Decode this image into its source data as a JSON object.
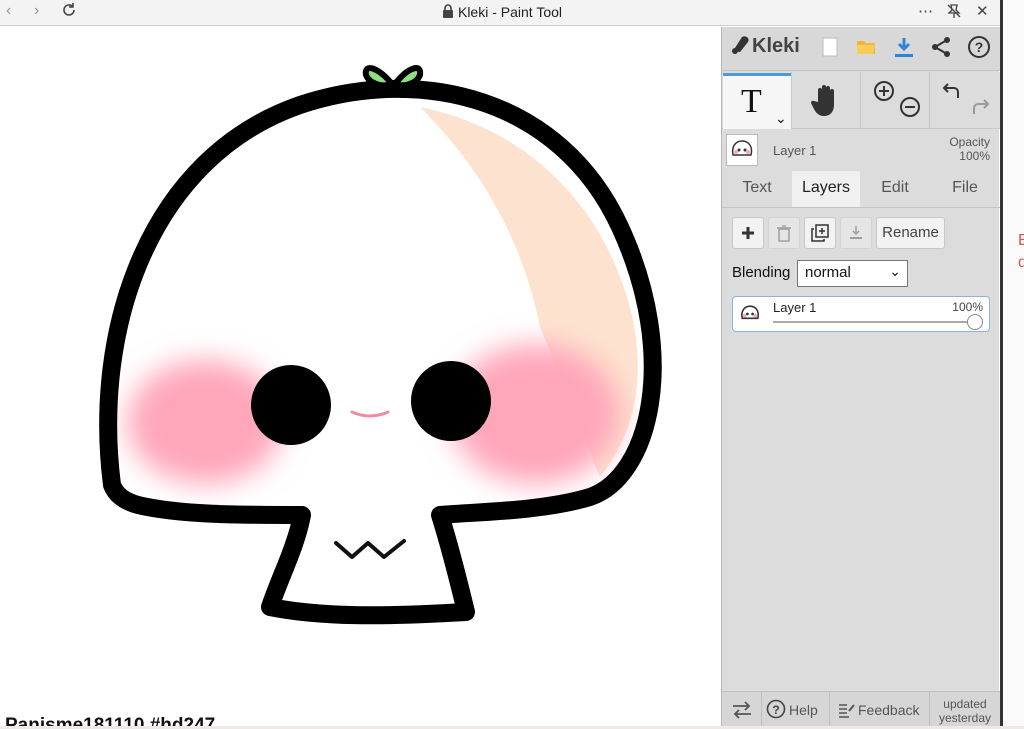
{
  "window": {
    "title": "Kleki - Paint Tool"
  },
  "canvas": {
    "watermark": "Panisme181110 #hd247"
  },
  "panel": {
    "logo": "Kleki",
    "layer_name": "Layer 1",
    "opacity_label": "Opacity",
    "opacity_value": "100%",
    "tabs": [
      "Text",
      "Layers",
      "Edit",
      "File"
    ],
    "active_tab": "Layers",
    "rename_label": "Rename",
    "blending_label": "Blending",
    "blending_value": "normal",
    "layers": [
      {
        "name": "Layer 1",
        "opacity": "100%"
      }
    ],
    "bottom": {
      "help": "Help",
      "feedback": "Feedback",
      "updated_line1": "updated",
      "updated_line2": "yesterday"
    }
  },
  "gutter": {
    "text": "E\nd"
  },
  "colors": {
    "accent": "#4b9cd6",
    "download": "#2f86d8",
    "folder": "#f2b630",
    "cheek": "#ffa6ba",
    "peach": "#fde3cf",
    "sprout": "#8ee083"
  },
  "icons": [
    "back-icon",
    "forward-icon",
    "reload-icon",
    "lock-icon",
    "more-icon",
    "pin-off-icon",
    "close-icon",
    "kleki-logo-icon",
    "new-icon",
    "open-folder-icon",
    "download-icon",
    "share-icon",
    "help-icon",
    "text-tool-icon",
    "hand-icon",
    "zoom-in-icon",
    "zoom-out-icon",
    "undo-icon",
    "redo-icon",
    "add-layer-icon",
    "delete-layer-icon",
    "duplicate-layer-icon",
    "merge-layer-icon",
    "swap-icon",
    "feedback-icon"
  ]
}
